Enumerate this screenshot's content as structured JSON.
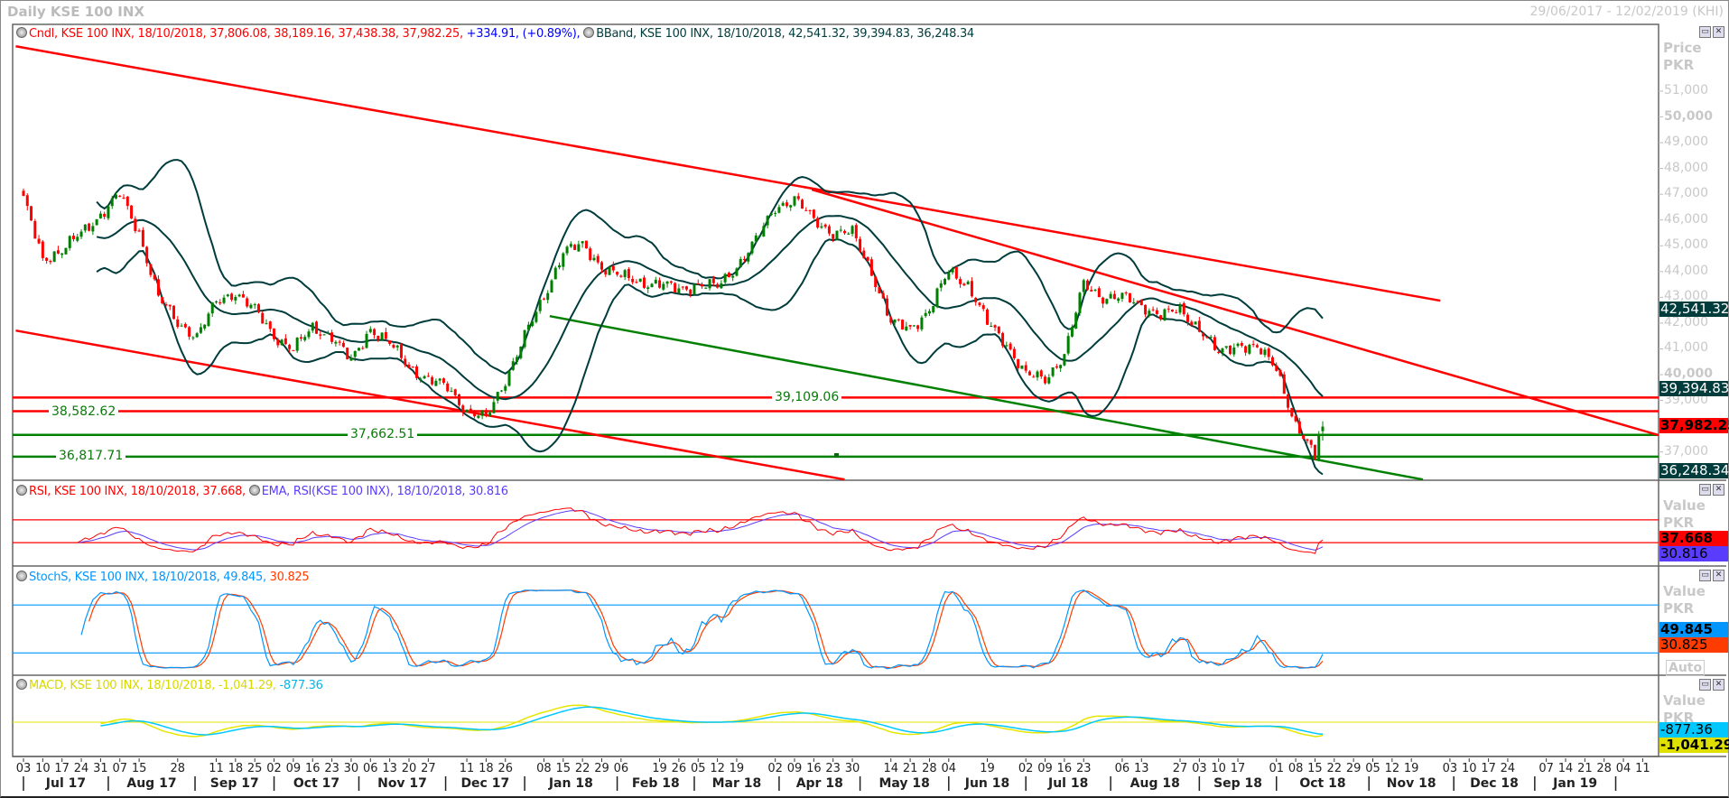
{
  "header": {
    "title": "Daily KSE 100 INX",
    "range": "29/06/2017 - 12/02/2019 (KHI)"
  },
  "legend": {
    "cndl": "Cndl, KSE 100 INX, 18/10/2018, 37,806.08, 38,189.16, 37,438.38, 37,982.25,",
    "change": "+334.91, (+0.89%),",
    "bband": "BBand, KSE 100 INX, 18/10/2018, 42,541.32, 39,394.83, 36,248.34",
    "rsi": "RSI, KSE 100 INX, 18/10/2018, 37.668,",
    "ema": "EMA, RSI(KSE 100 INX), 18/10/2018, 30.816",
    "stoch": "StochS, KSE 100 INX, 18/10/2018, 49.845,",
    "stoch_d": "30.825",
    "macd": "MACD, KSE 100 INX, 18/10/2018, -1,041.29,",
    "macd_signal": "-877.36"
  },
  "price_axis": {
    "title1": "Price",
    "title2": "PKR",
    "badges": {
      "bb_upper": "42,541.32",
      "bb_mid": "39,394.83",
      "last": "37,982.25",
      "bb_lower": "36,248.34"
    }
  },
  "rsi_axis": {
    "title1": "Value",
    "title2": "PKR",
    "rsi": "37.668",
    "ema": "30.816"
  },
  "stoch_axis": {
    "title1": "Value",
    "title2": "PKR",
    "k": "49.845",
    "d": "30.825",
    "auto": "Auto"
  },
  "macd_axis": {
    "title1": "Value",
    "title2": "PKR",
    "signal": "-877.36",
    "macd": "-1,041.29"
  },
  "colors": {
    "up": "#008000",
    "down": "#ff0000",
    "bband": "#003c3c",
    "rsi": "#ff0000",
    "ema": "#5a3cff",
    "stoch_k": "#0096ff",
    "stoch_d": "#ff3c00",
    "macd": "#e6e600",
    "signal": "#00c8ff"
  },
  "chart_data": {
    "type": "candlestick",
    "title": "Daily KSE 100 INX",
    "ylabel": "Price PKR",
    "ylim": [
      36000,
      52000
    ],
    "y_ticks": [
      "51,000",
      "50,000",
      "49,000",
      "48,000",
      "47,000",
      "46,000",
      "45,000",
      "44,000",
      "43,000",
      "42,000",
      "41,000",
      "40,000",
      "39,000",
      "37,000"
    ],
    "y_tick_values": [
      51000,
      50000,
      49000,
      48000,
      47000,
      46000,
      45000,
      44000,
      43000,
      42000,
      41000,
      40000,
      39000,
      37000
    ],
    "weekly_close_from_03_07_2017": [
      46800,
      44500,
      44800,
      45500,
      46200,
      47000,
      45500,
      43000,
      42000,
      41500,
      42800,
      43200,
      42500,
      41500,
      41000,
      41800,
      41500,
      40500,
      41800,
      41200,
      40300,
      39800,
      39500,
      38600,
      38300,
      39800,
      41500,
      43000,
      44800,
      45000,
      44200,
      43800,
      43600,
      43500,
      43300,
      43500,
      43400,
      44200,
      45200,
      46500,
      46800,
      46000,
      45500,
      45500,
      44000,
      42000,
      41800,
      42500,
      44000,
      43500,
      42000,
      41200,
      40000,
      39800,
      40800,
      43500,
      43000,
      43000,
      42700,
      42300,
      42500,
      41800,
      40800,
      41200,
      41000,
      40300,
      38000,
      36800
    ],
    "last_candle": {
      "date": "18/10/2018",
      "open": 37806.08,
      "high": 38189.16,
      "low": 37438.38,
      "close": 37982.25,
      "prev_close": 37647.34
    },
    "bbands_last": {
      "upper": 42541.32,
      "middle": 39394.83,
      "lower": 36248.34
    },
    "horizontal_lines": [
      {
        "value": 39109.06,
        "label": "39,109.06",
        "color": "#ff0000"
      },
      {
        "value": 38582.62,
        "label": "38,582.62",
        "color": "#ff0000"
      },
      {
        "value": 37662.51,
        "label": "37,662.51",
        "color": "#008000"
      },
      {
        "value": 36817.71,
        "label": "36,817.71",
        "color": "#008000"
      }
    ],
    "trendlines": [
      {
        "from": {
          "week": -0.4,
          "price": 52740
        },
        "to": {
          "week": 73.5,
          "price": 42870
        },
        "color": "#ff0000"
      },
      {
        "from": {
          "week": -0.4,
          "price": 41710
        },
        "to": {
          "week": 42.6,
          "price": 35930
        },
        "color": "#ff0000"
      },
      {
        "from": {
          "week": 40.9,
          "price": 47180
        },
        "to": {
          "week": 85.3,
          "price": 37550
        },
        "color": "#ff0000"
      },
      {
        "from": {
          "week": 27.3,
          "price": 42270
        },
        "to": {
          "week": 72.6,
          "price": 35930
        },
        "color": "#008000"
      }
    ],
    "rsi_levels": [
      70,
      30
    ],
    "stoch_levels": [
      80,
      20
    ],
    "x_ticks": [
      [
        "03",
        0
      ],
      [
        "10",
        1
      ],
      [
        "17",
        2
      ],
      [
        "24",
        3
      ],
      [
        "31",
        4
      ],
      [
        "07",
        5
      ],
      [
        "15",
        6
      ],
      [
        "28",
        8
      ],
      [
        "11",
        10
      ],
      [
        "18",
        11
      ],
      [
        "25",
        12
      ],
      [
        "02",
        13
      ],
      [
        "09",
        14
      ],
      [
        "16",
        15
      ],
      [
        "23",
        16
      ],
      [
        "30",
        17
      ],
      [
        "06",
        18
      ],
      [
        "13",
        19
      ],
      [
        "20",
        20
      ],
      [
        "27",
        21
      ],
      [
        "11",
        23
      ],
      [
        "18",
        24
      ],
      [
        "26",
        25
      ],
      [
        "08",
        27
      ],
      [
        "15",
        28
      ],
      [
        "22",
        29
      ],
      [
        "29",
        30
      ],
      [
        "06",
        31
      ],
      [
        "19",
        33
      ],
      [
        "26",
        34
      ],
      [
        "05",
        35
      ],
      [
        "12",
        36
      ],
      [
        "19",
        37
      ],
      [
        "02",
        39
      ],
      [
        "09",
        40
      ],
      [
        "16",
        41
      ],
      [
        "23",
        42
      ],
      [
        "30",
        43
      ],
      [
        "14",
        45
      ],
      [
        "21",
        46
      ],
      [
        "28",
        47
      ],
      [
        "04",
        48
      ],
      [
        "19",
        50
      ],
      [
        "02",
        52
      ],
      [
        "09",
        53
      ],
      [
        "16",
        54
      ],
      [
        "23",
        55
      ],
      [
        "06",
        57
      ],
      [
        "13",
        58
      ],
      [
        "27",
        60
      ],
      [
        "03",
        61
      ],
      [
        "10",
        62
      ],
      [
        "17",
        63
      ],
      [
        "01",
        65
      ],
      [
        "08",
        66
      ],
      [
        "15",
        67
      ],
      [
        "22",
        68
      ],
      [
        "29",
        69
      ],
      [
        "05",
        70
      ],
      [
        "12",
        71
      ],
      [
        "19",
        72
      ],
      [
        "03",
        74
      ],
      [
        "10",
        75
      ],
      [
        "17",
        76
      ],
      [
        "24",
        77
      ],
      [
        "07",
        79
      ],
      [
        "14",
        80
      ],
      [
        "21",
        81
      ],
      [
        "28",
        82
      ],
      [
        "04",
        83
      ],
      [
        "11",
        84
      ]
    ],
    "months": [
      [
        "Jul 17",
        0
      ],
      [
        "Aug 17",
        4.4
      ],
      [
        "Sep 17",
        8.9
      ],
      [
        "Oct 17",
        13
      ],
      [
        "Nov 17",
        17.4
      ],
      [
        "Dec 17",
        21.9
      ],
      [
        "Jan 18",
        26
      ],
      [
        "Feb 18",
        30.8
      ],
      [
        "Mar 18",
        34.8
      ],
      [
        "Apr 18",
        39.2
      ],
      [
        "May 18",
        43.4
      ],
      [
        "Jun 18",
        48
      ],
      [
        "Jul 18",
        52
      ],
      [
        "Aug 18",
        56.4
      ],
      [
        "Sep 18",
        61
      ],
      [
        "Oct 18",
        65
      ],
      [
        "Nov 18",
        69.8
      ],
      [
        "Dec 18",
        74.2
      ],
      [
        "Jan 19",
        78.4
      ],
      [
        "",
        82.6
      ]
    ]
  }
}
